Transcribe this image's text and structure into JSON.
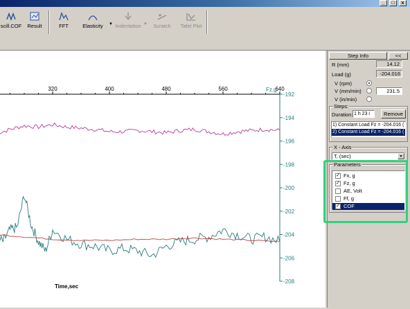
{
  "toolbar": {
    "items": [
      {
        "label": "scill.COF",
        "icon": "scill-icon",
        "disabled": false
      },
      {
        "label": "Result",
        "icon": "result-icon",
        "disabled": false
      },
      {
        "label": "FFT",
        "icon": "fft-icon",
        "disabled": false
      },
      {
        "label": "Elasticity",
        "icon": "elasticity-icon",
        "disabled": false
      },
      {
        "label": "Indentation",
        "icon": "indentation-icon",
        "disabled": true
      },
      {
        "label": "Scratch",
        "icon": "scratch-icon",
        "disabled": true
      },
      {
        "label": "Tafel Plot",
        "icon": "tafel-plot-icon",
        "disabled": true
      }
    ]
  },
  "window_buttons": [
    "_",
    "□",
    "x"
  ],
  "chart": {
    "x_ticks": [
      "320",
      "400",
      "480",
      "560",
      "640"
    ],
    "right_axis_label": "Fz,g",
    "y_ticks": [
      "-192",
      "-194",
      "-196",
      "-198",
      "-200",
      "-202",
      "-204",
      "-206",
      "-208"
    ],
    "xlabel": "Time,sec",
    "colors": {
      "fz": "#b93a9a",
      "fx": "#2a7a7a",
      "cof": "#c04040",
      "axis": "#2a7a7a"
    }
  },
  "chart_data": {
    "type": "line",
    "xlabel": "Time,sec",
    "ylabel": "Fz,g",
    "xlim": [
      240,
      640
    ],
    "ylim": [
      -208,
      -192
    ],
    "series": [
      {
        "name": "Fz, g",
        "x": [
          240,
          260,
          280,
          300,
          320,
          340,
          360,
          380,
          400,
          420,
          440,
          460,
          480,
          500,
          520,
          540,
          560,
          580,
          600,
          620,
          640
        ],
        "y": [
          -195.4,
          -195.0,
          -194.7,
          -194.8,
          -194.6,
          -194.8,
          -194.9,
          -195.0,
          -195.2,
          -195.2,
          -195.1,
          -195.2,
          -195.3,
          -195.1,
          -195.0,
          -195.2,
          -195.4,
          -195.2,
          -195.1,
          -195.0,
          -195.1
        ]
      },
      {
        "name": "Fx, g",
        "x": [
          240,
          250,
          260,
          270,
          280,
          290,
          300,
          310,
          320,
          340,
          360,
          380,
          400,
          420,
          440,
          460,
          480,
          500,
          520,
          540,
          560,
          580,
          600,
          620,
          640
        ],
        "y": [
          -204.2,
          -204.6,
          -203.6,
          -203.4,
          -200.6,
          -203.2,
          -204.6,
          -205.4,
          -203.6,
          -204.4,
          -204.8,
          -205.0,
          -205.4,
          -205.2,
          -205.4,
          -205.8,
          -205.0,
          -204.6,
          -204.4,
          -204.2,
          -203.6,
          -204.0,
          -204.4,
          -204.2,
          -204.6
        ]
      },
      {
        "name": "COF",
        "x": [
          240,
          280,
          320,
          360,
          400,
          440,
          480,
          520,
          560,
          600,
          640
        ],
        "y": [
          -204.0,
          -204.2,
          -204.4,
          -204.5,
          -204.5,
          -204.4,
          -204.4,
          -204.3,
          -204.4,
          -204.5,
          -204.6
        ]
      }
    ]
  },
  "panel": {
    "step_info_title": "Step Info",
    "collapse_btn": "<<",
    "r_label": "R (mm)",
    "r_value": "14.12",
    "load_label": "Load (g)",
    "load_value": "-204.016",
    "v_rpm_label": "V (rpm)",
    "v_mmmin_label": "V (mm/min)",
    "v_mmmin_value": "231.5",
    "v_inmin_label": "V (in/min)",
    "steps_title": "Steps:",
    "duration_label": "Duration:",
    "duration_value": "1 h 23 i",
    "remove_btn": "Remove",
    "steps": [
      "1) Constant Load Fz = -204.016 (",
      "2) Constant Load Fz = -204.016 ("
    ],
    "xaxis_title": "X - Axis",
    "xaxis_value": "T, (sec)",
    "params_title": "Parameters",
    "params": [
      {
        "label": "Fx, g",
        "checked": true,
        "selected": false
      },
      {
        "label": "Fz, g",
        "checked": true,
        "selected": false
      },
      {
        "label": "AE, Volt",
        "checked": false,
        "selected": false
      },
      {
        "label": "Ff, g",
        "checked": false,
        "selected": false
      },
      {
        "label": "COF",
        "checked": true,
        "selected": true
      }
    ]
  }
}
